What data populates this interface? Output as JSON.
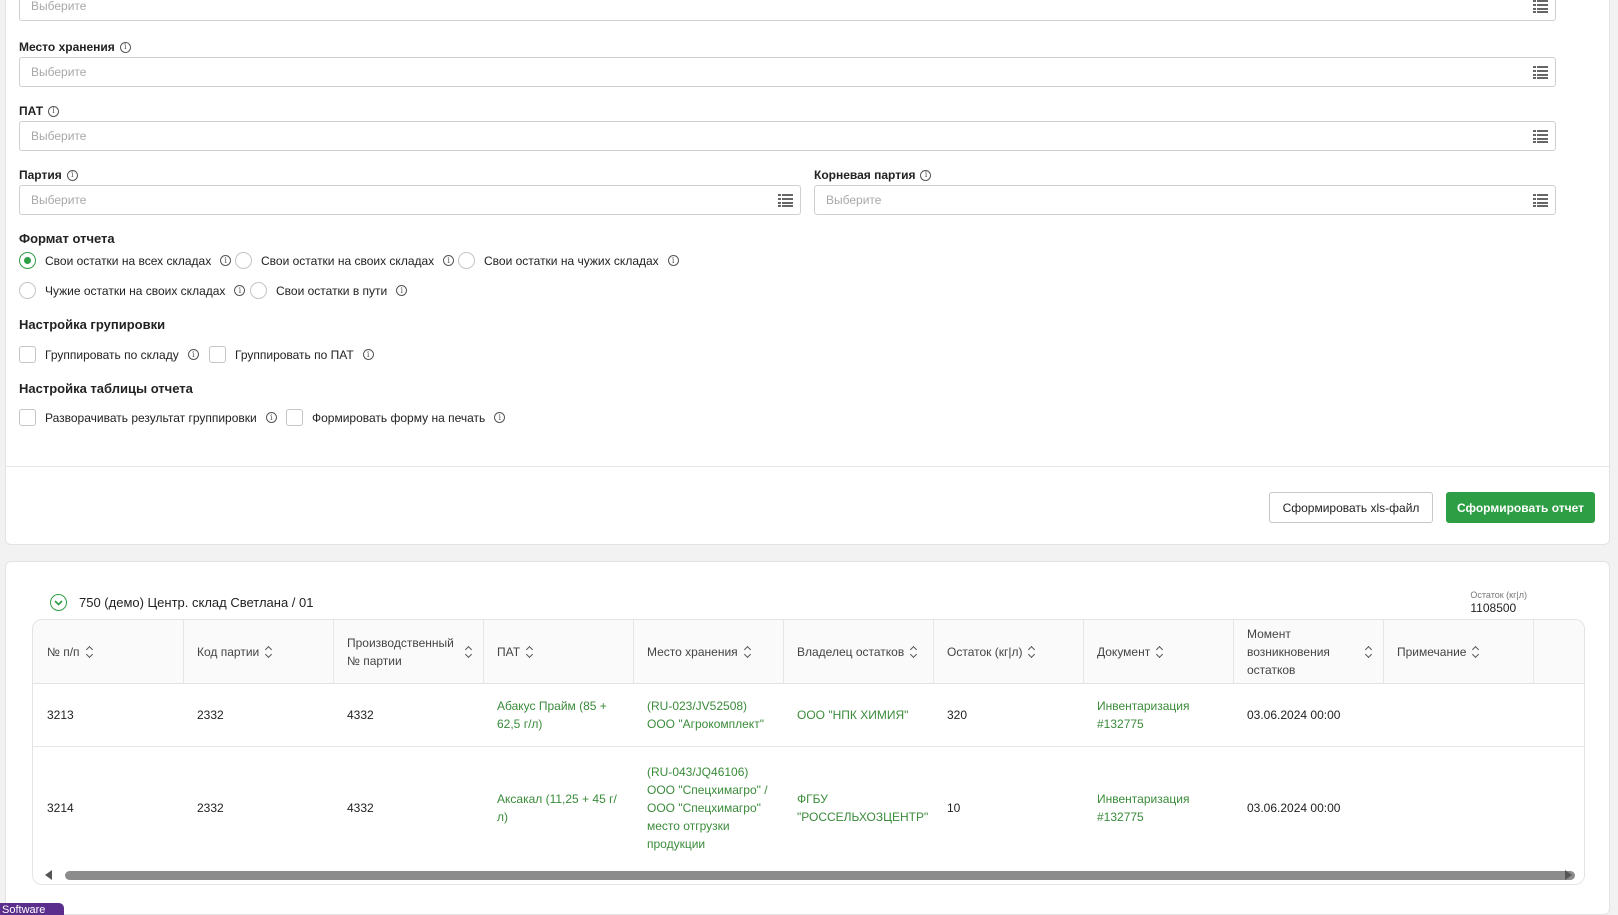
{
  "filters": {
    "top_placeholder": "Выберите",
    "storage": {
      "label": "Место хранения",
      "placeholder": "Выберите"
    },
    "pat": {
      "label": "ПАТ",
      "placeholder": "Выберите"
    },
    "batch": {
      "label": "Партия",
      "placeholder": "Выберите"
    },
    "root_batch": {
      "label": "Корневая партия",
      "placeholder": "Выберите"
    }
  },
  "report_format": {
    "title": "Формат отчета",
    "options": [
      {
        "label": "Свои остатки на всех складах",
        "selected": true
      },
      {
        "label": "Свои остатки на своих складах",
        "selected": false
      },
      {
        "label": "Свои остатки на чужих складах",
        "selected": false
      },
      {
        "label": "Чужие остатки на своих складах",
        "selected": false
      },
      {
        "label": "Свои остатки в пути",
        "selected": false
      }
    ]
  },
  "grouping": {
    "title": "Настройка групировки",
    "options": [
      {
        "label": "Группировать по складу",
        "checked": false
      },
      {
        "label": "Группировать по ПАТ",
        "checked": false
      }
    ]
  },
  "table_settings": {
    "title": "Настройка таблицы отчета",
    "options": [
      {
        "label": "Разворачивать результат группировки",
        "checked": false
      },
      {
        "label": "Формировать форму на печать",
        "checked": false
      }
    ]
  },
  "actions": {
    "xls_label": "Сформировать xls-файл",
    "report_label": "Сформировать отчет"
  },
  "group": {
    "title": "750 (демо) Центр. склад Светлана / 01",
    "stat_label": "Остаток (кг|л)",
    "stat_value": "1108500"
  },
  "table": {
    "columns": [
      "№ п/п",
      "Код партии",
      "Производственный № партии",
      "ПАТ",
      "Место хранения",
      "Владелец остатков",
      "Остаток (кг|л)",
      "Документ",
      "Момент возникновения остатков",
      "Примечание"
    ],
    "rows": [
      {
        "num": "3213",
        "code": "2332",
        "prod_num": "4332",
        "pat": "Абакус Прайм (85 + 62,5 г/л)",
        "storage": "(RU-023/JV52508) ООО \"Агрокомплект\"",
        "owner": "ООО \"НПК ХИМИЯ\"",
        "rest": "320",
        "doc": "Инвентаризация #132775",
        "moment": "03.06.2024 00:00",
        "note": ""
      },
      {
        "num": "3214",
        "code": "2332",
        "prod_num": "4332",
        "pat": "Аксакал (11,25 + 45 г/л)",
        "storage": "(RU-043/JQ46106) ООО \"Спецхимагро\" / ООО \"Спецхимагро\" место отгрузки продукции",
        "owner": "ФГБУ \"РОССЕЛЬХОЗЦЕНТР\"",
        "rest": "10",
        "doc": "Инвентаризация #132775",
        "moment": "03.06.2024 00:00",
        "note": ""
      }
    ]
  },
  "badge_text": "Software",
  "colors": {
    "accent": "#2e9e44",
    "link": "#3a8b3a",
    "badge": "#5b2d8c"
  }
}
